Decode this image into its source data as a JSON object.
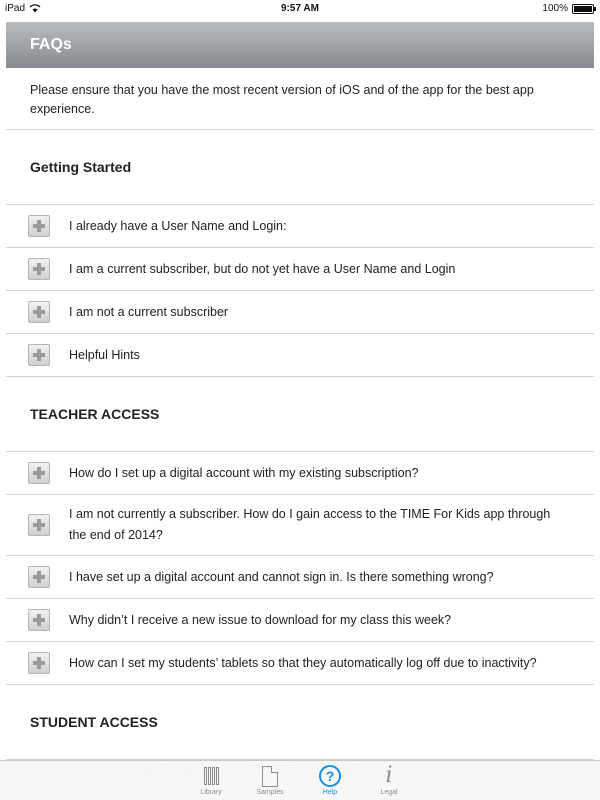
{
  "status_bar": {
    "device": "iPad",
    "time": "9:57 AM",
    "battery": "100%"
  },
  "header": {
    "title": "FAQs"
  },
  "intro": "Please ensure that you have the most recent version of iOS and of the app for the best app experience.",
  "sections": [
    {
      "title": "Getting Started",
      "items": [
        "I already have a User Name and Login:",
        "I am a current subscriber, but do not yet have a User Name and Login",
        "I am not a current subscriber",
        "Helpful Hints"
      ]
    },
    {
      "title": "TEACHER ACCESS",
      "items": [
        "How do I set up a digital account with my existing subscription?",
        "I am not currently a subscriber. How do I gain access to the TIME For Kids app through the end of 2014?",
        "I have set up a digital account and cannot sign in. Is there something wrong?",
        "Why didn’t I receive a new issue to download for my class this week?",
        "How can I set my students’ tablets so that they automatically log off due to inactivity?"
      ]
    },
    {
      "title": "STUDENT ACCESS",
      "items": [
        "How do I assign Student ... to ... TIME For Kids app?"
      ]
    }
  ],
  "tab_bar": {
    "tabs": [
      {
        "label": "Library",
        "icon": "library-icon"
      },
      {
        "label": "Samples",
        "icon": "document-icon"
      },
      {
        "label": "Help",
        "icon": "help-icon",
        "active": true
      },
      {
        "label": "Legal",
        "icon": "info-icon"
      }
    ]
  },
  "colors": {
    "accent": "#1a8fe0",
    "header_top": "#b9bcc0",
    "header_bottom": "#878a8e",
    "divider": "#d4d4d4"
  }
}
